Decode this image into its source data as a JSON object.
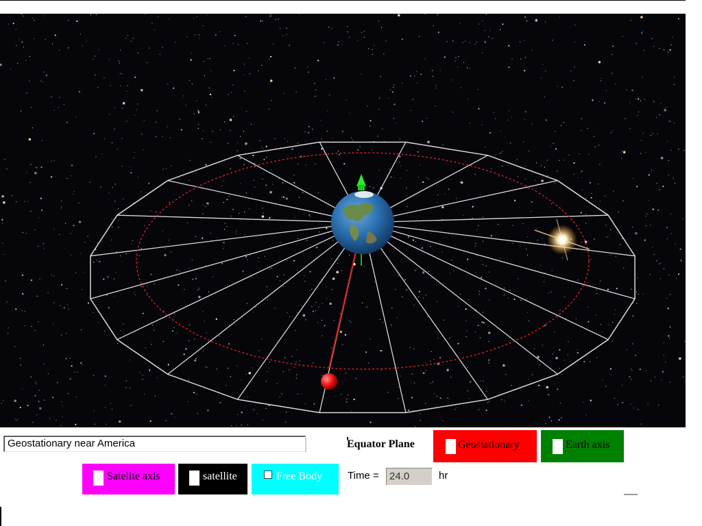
{
  "applet": {
    "preset_select": {
      "value": "Geostationary near America"
    },
    "equator_plane_label": "Equator Plane",
    "toggles": {
      "geostationary": {
        "label": "Geostationary",
        "color": "#ff0000"
      },
      "earth_axis": {
        "label": "Earth axis",
        "color": "#008000"
      },
      "satellite_axis": {
        "label": "Satelite axis",
        "color": "#ff00ff"
      },
      "satellite": {
        "label": "satellite",
        "color": "#000000"
      },
      "free_body": {
        "label": "Free Body",
        "color": "#00ffff",
        "checked": false
      }
    },
    "time": {
      "label": "Time =",
      "value": "24.0",
      "unit": "hr"
    }
  },
  "scene": {
    "background": "starfield",
    "objects": [
      "earth",
      "equator-plane-grid",
      "geostationary-orbit",
      "satellite",
      "earth-axis-arrow",
      "sun-flare"
    ],
    "colors": {
      "orbit": "#cc2020",
      "grid": "#dcdcdc",
      "satellite": "#ff1010",
      "axis": "#10c010"
    }
  }
}
